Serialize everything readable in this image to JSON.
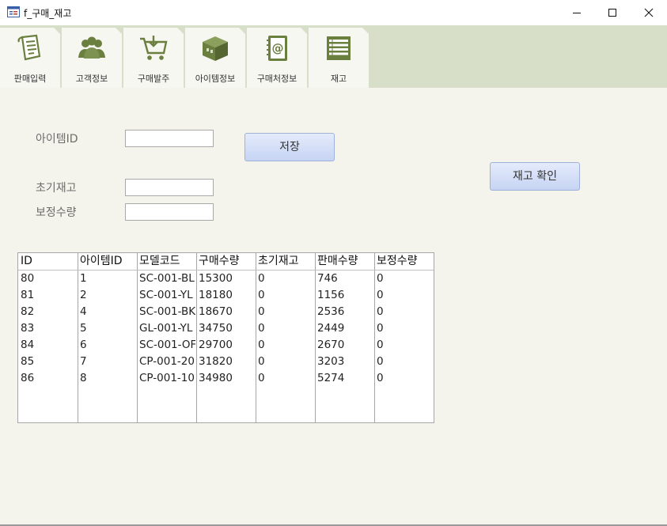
{
  "window": {
    "title": "f_구매_재고",
    "icons": [
      "form-icon",
      "minimize-icon",
      "maximize-icon",
      "close-icon"
    ]
  },
  "tabs": [
    {
      "label": "판매입력",
      "icon": "receipt-icon"
    },
    {
      "label": "고객정보",
      "icon": "users-icon"
    },
    {
      "label": "구매발주",
      "icon": "cart-icon"
    },
    {
      "label": "아이템정보",
      "icon": "box-icon"
    },
    {
      "label": "구매처정보",
      "icon": "address-book-icon"
    },
    {
      "label": "재고",
      "icon": "list-icon"
    }
  ],
  "form": {
    "item_id_label": "아이템ID",
    "item_id_value": "",
    "initial_stock_label": "초기재고",
    "initial_stock_value": "",
    "adjust_qty_label": "보정수량",
    "adjust_qty_value": "",
    "save_label": "저장",
    "check_stock_label": "재고 확인"
  },
  "table": {
    "columns": [
      "ID",
      "아이템ID",
      "모델코드",
      "구매수량",
      "초기재고",
      "판매수량",
      "보정수량"
    ],
    "rows": [
      [
        "80",
        "1",
        "SC-001-BL",
        "15300",
        "0",
        "746",
        "0"
      ],
      [
        "81",
        "2",
        "SC-001-YL",
        "18180",
        "0",
        "1156",
        "0"
      ],
      [
        "82",
        "4",
        "SC-001-BK",
        "18670",
        "0",
        "2536",
        "0"
      ],
      [
        "83",
        "5",
        "GL-001-YL",
        "34750",
        "0",
        "2449",
        "0"
      ],
      [
        "84",
        "6",
        "SC-001-OF",
        "29700",
        "0",
        "2670",
        "0"
      ],
      [
        "85",
        "7",
        "CP-001-20",
        "31820",
        "0",
        "3203",
        "0"
      ],
      [
        "86",
        "8",
        "CP-001-10",
        "34980",
        "0",
        "5274",
        "0"
      ]
    ]
  },
  "colors": {
    "accent_icon": "#6b7f3f",
    "tab_strip": "#d7dfc9",
    "background": "#f4f4ec",
    "button": "#c6d4f3"
  }
}
